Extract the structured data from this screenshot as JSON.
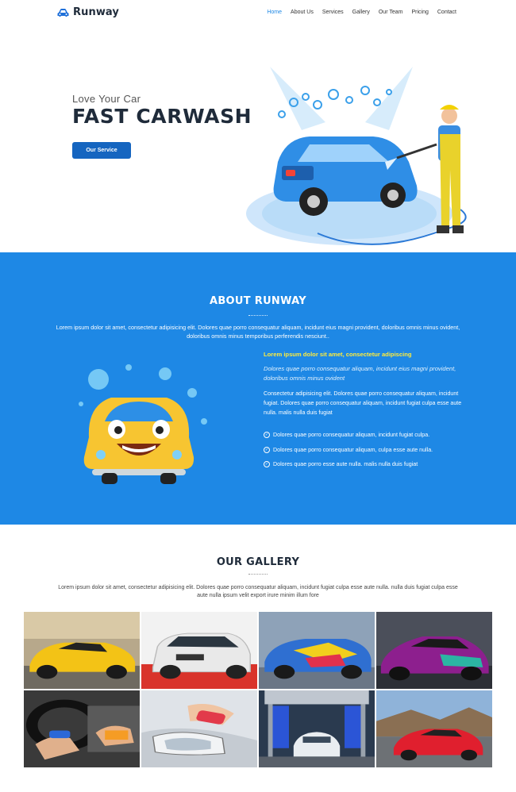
{
  "header": {
    "brand": "Runway",
    "nav": [
      "Home",
      "About Us",
      "Services",
      "Gallery",
      "Our Team",
      "Pricing",
      "Contact"
    ],
    "active_index": 0
  },
  "hero": {
    "subtitle": "Love Your Car",
    "title": "FAST CARWASH",
    "button": "Our Service"
  },
  "about": {
    "title": "ABOUT RUNWAY",
    "description": "Lorem ipsum dolor sit amet, consectetur adipisicing elit. Dolores quae porro consequatur aliquam, incidunt eius magni provident, doloribus omnis minus ovident, doloribus omnis minus temporibus perferendis nesciunt..",
    "lead": "Lorem ipsum dolor sit amet, consectetur adipiscing",
    "italic": "Dolores quae porro consequatur aliquam, incidunt eius magni provident, doloribus omnis minus ovident",
    "paragraph": "Consectetur adipisicing elit. Dolores quae porro consequatur aliquam, incidunt fugiat. Dolores quae porro consequatur aliquam, incidunt fugiat culpa esse aute nulla. malis nulla duis fugiat",
    "list": [
      "Dolores quae porro consequatur aliquam, incidunt fugiat culpa.",
      "Dolores quae porro consequatur aliquam, culpa esse aute nulla.",
      "Dolores quae porro esse aute nulla. malis nulla duis fugiat"
    ]
  },
  "gallery": {
    "title": "OUR GALLERY",
    "description": "Lorem ipsum dolor sit amet, consectetur adipisicing elit. Dolores quae porro consequatur aliquam, incidunt fugiat culpa esse aute nulla. nulla duis fugiat culpa esse aute nulla ipsum velit export irure minim illum fore"
  },
  "colors": {
    "primary": "#1e88e5",
    "button": "#1565c0",
    "dark": "#1f2b3a",
    "accent_yellow": "#ffeb3b"
  }
}
